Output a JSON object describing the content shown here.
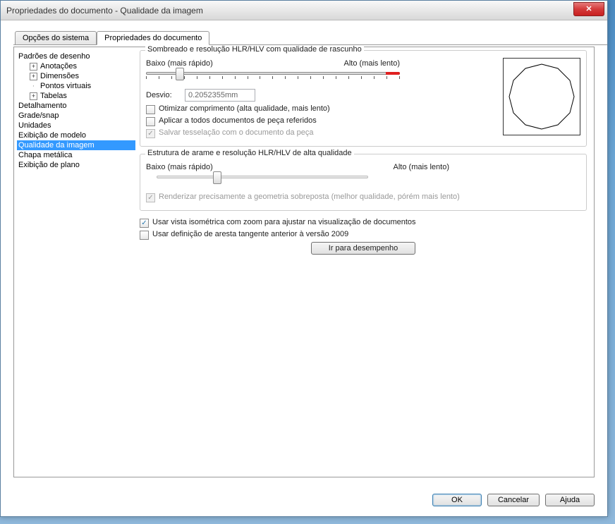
{
  "window": {
    "title": "Propriedades do documento - Qualidade da imagem"
  },
  "tabs": {
    "system": "Opções do sistema",
    "document": "Propriedades do documento"
  },
  "tree": {
    "root0": "Padrões de desenho",
    "anot": "Anotações",
    "dim": "Dimensões",
    "pontos": "Pontos virtuais",
    "tabelas": "Tabelas",
    "detal": "Detalhamento",
    "grade": "Grade/snap",
    "unid": "Unidades",
    "exmod": "Exibição de modelo",
    "qual": "Qualidade da imagem",
    "chapa": "Chapa metálica",
    "explano": "Exibição de plano"
  },
  "group1": {
    "title": "Sombreado e resolução HLR/HLV com qualidade de rascunho",
    "low": "Baixo (mais rápido)",
    "high": "Alto (mais lento)",
    "deviation_label": "Desvio:",
    "deviation_value": "0.2052355mm",
    "opt_compr": "Otimizar comprimento (alta qualidade, mais lento)",
    "apply_all": "Aplicar a todos documentos de peça referidos",
    "save_tess": "Salvar tesselação com o documento da peça"
  },
  "group2": {
    "title": "Estrutura de arame e resolução HLR/HLV de alta qualidade",
    "low": "Baixo (mais rápido)",
    "high": "Alto (mais lento)",
    "render_precise": "Renderizar precisamente a geometria sobreposta (melhor qualidade, pórém mais lento)"
  },
  "checks": {
    "use_iso": "Usar vista isométrica com zoom para ajustar na visualização de documentos",
    "use_tan": "Usar definição de aresta tangente anterior à versão 2009"
  },
  "buttons": {
    "perf": "Ir para desempenho",
    "ok": "OK",
    "cancel": "Cancelar",
    "help": "Ajuda"
  }
}
